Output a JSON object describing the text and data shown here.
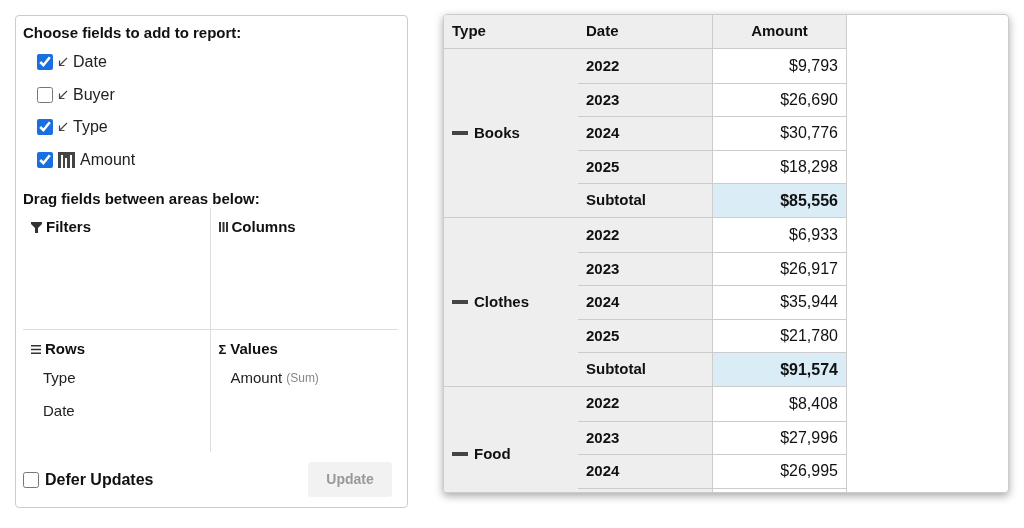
{
  "panel": {
    "title": "Choose fields to add to report:",
    "fields": [
      {
        "label": "Date",
        "kind": "dimension",
        "checked": true
      },
      {
        "label": "Buyer",
        "kind": "dimension",
        "checked": false
      },
      {
        "label": "Type",
        "kind": "dimension",
        "checked": true
      },
      {
        "label": "Amount",
        "kind": "measure",
        "checked": true
      }
    ],
    "areas_title": "Drag fields between areas below:",
    "areas": [
      {
        "label": "Filters",
        "kind": "filters"
      },
      {
        "label": "Columns",
        "kind": "columns"
      },
      {
        "label": "Rows",
        "kind": "rows",
        "items": [
          {
            "label": "Type"
          },
          {
            "label": "Date"
          }
        ]
      },
      {
        "label": "Values",
        "kind": "values",
        "symbol": "Σ",
        "items": [
          {
            "label": "Amount",
            "note": "(Sum)"
          }
        ]
      }
    ],
    "defer_updates": {
      "label": "Defer Updates",
      "checked": false
    },
    "update_button": {
      "label": "Update",
      "disabled": true
    }
  },
  "grid": {
    "columns": [
      "Type",
      "Date",
      "Amount"
    ],
    "groups": [
      {
        "label": "Books",
        "expanded": true,
        "rows": [
          {
            "date": "2022",
            "amount": "$9,793"
          },
          {
            "date": "2023",
            "amount": "$26,690"
          },
          {
            "date": "2024",
            "amount": "$30,776"
          },
          {
            "date": "2025",
            "amount": "$18,298"
          }
        ],
        "subtotal": {
          "label": "Subtotal",
          "amount": "$85,556"
        }
      },
      {
        "label": "Clothes",
        "expanded": true,
        "rows": [
          {
            "date": "2022",
            "amount": "$6,933"
          },
          {
            "date": "2023",
            "amount": "$26,917"
          },
          {
            "date": "2024",
            "amount": "$35,944"
          },
          {
            "date": "2025",
            "amount": "$21,780"
          }
        ],
        "subtotal": {
          "label": "Subtotal",
          "amount": "$91,574"
        }
      },
      {
        "label": "Food",
        "expanded": true,
        "rows": [
          {
            "date": "2022",
            "amount": "$8,408"
          },
          {
            "date": "2023",
            "amount": "$27,996"
          },
          {
            "date": "2024",
            "amount": "$26,995"
          }
        ]
      }
    ]
  }
}
